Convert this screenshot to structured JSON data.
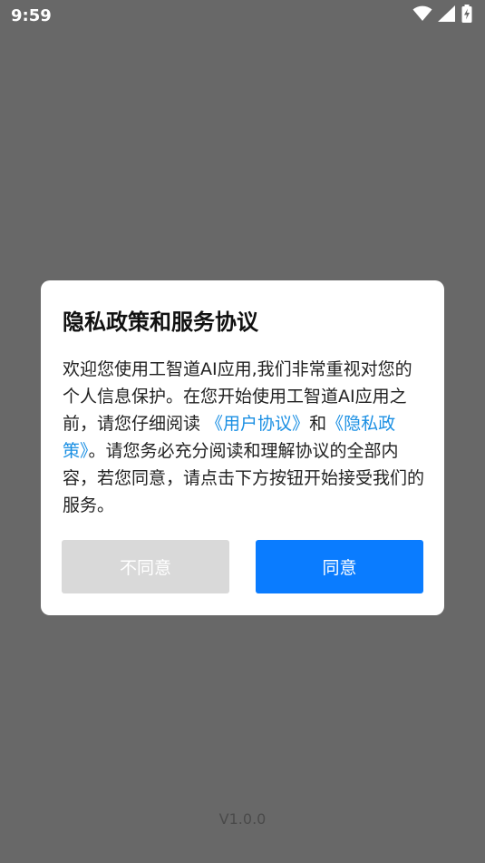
{
  "status_bar": {
    "time": "9:59",
    "icons": [
      "wifi-icon",
      "signal-icon",
      "battery-charging-icon"
    ]
  },
  "dialog": {
    "title": "隐私政策和服务协议",
    "body_part1": "欢迎您使用工智道AI应用,我们非常重视对您的个人信息保护。在您开始使用工智道AI应用之前，请您仔细阅读 ",
    "user_agreement_link": "《用户协议》",
    "body_and": "和",
    "privacy_policy_link": "《隐私政策》",
    "body_part2": "。请您务必充分阅读和理解协议的全部内容，若您同意，请点击下方按钮开始接受我们的服务。",
    "disagree_label": "不同意",
    "agree_label": "同意"
  },
  "version": "V1.0.0",
  "colors": {
    "overlay": "#686868",
    "link": "#1a8fe3",
    "agree_button": "#0a7cff",
    "disagree_button": "#d9d9d9"
  }
}
